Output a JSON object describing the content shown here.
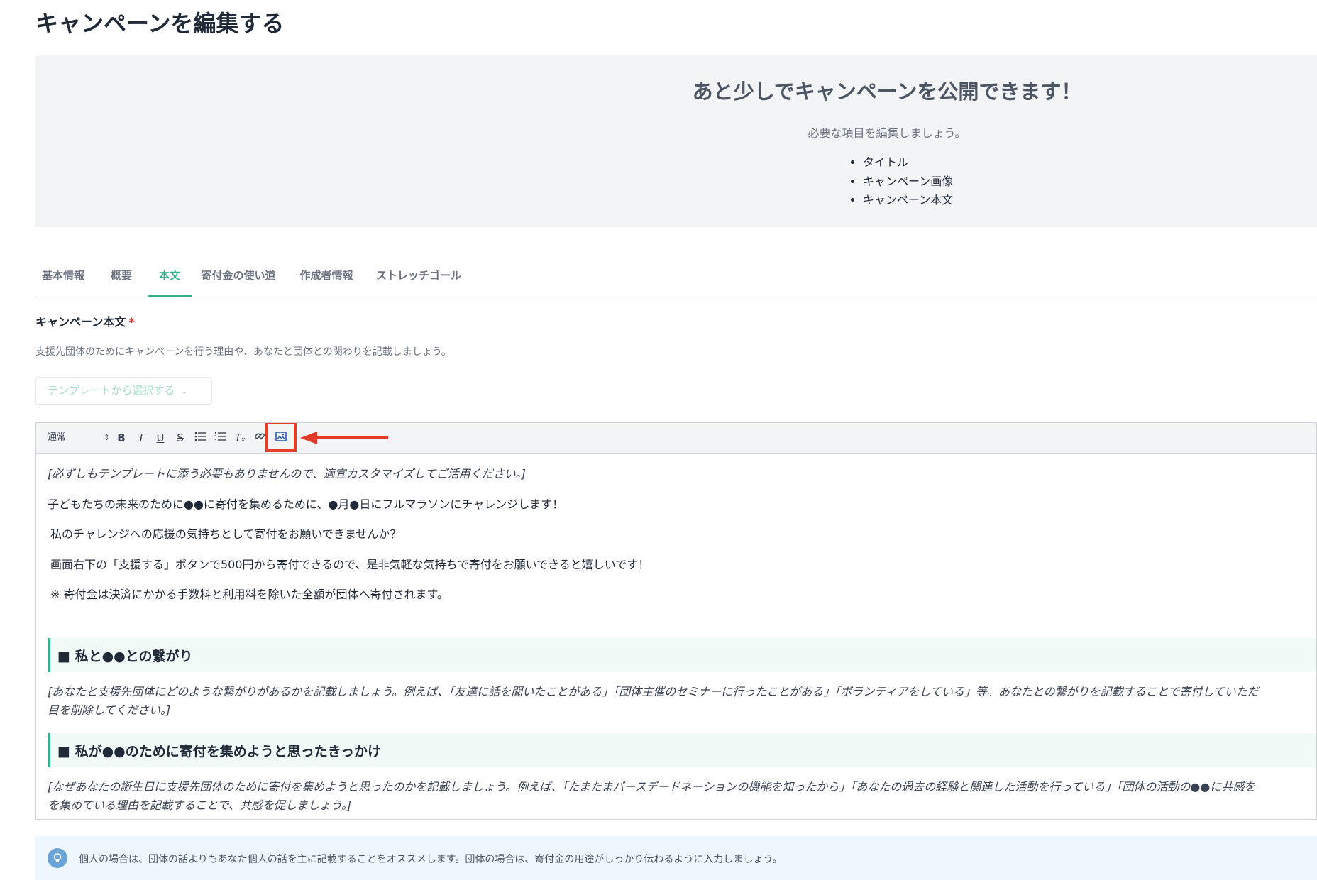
{
  "page": {
    "title": "キャンペーンを編集する"
  },
  "notice": {
    "heading": "あと少しでキャンペーンを公開できます！",
    "subheading": "必要な項目を編集しましょう。",
    "items": [
      "タイトル",
      "キャンペーン画像",
      "キャンペーン本文"
    ]
  },
  "tabs": [
    {
      "label": "基本情報",
      "active": false
    },
    {
      "label": "概要",
      "active": false
    },
    {
      "label": "本文",
      "active": true
    },
    {
      "label": "寄付金の使い道",
      "active": false
    },
    {
      "label": "作成者情報",
      "active": false
    },
    {
      "label": "ストレッチゴール",
      "active": false
    }
  ],
  "field": {
    "label": "キャンペーン本文",
    "required_mark": "*",
    "description": "支援先団体のためにキャンペーンを行う理由や、あなたと団体との関わりを記載しましょう。"
  },
  "template_button": {
    "label": "テンプレートから選択する"
  },
  "toolbar": {
    "format_select": "通常",
    "buttons": [
      "bold",
      "italic",
      "underline",
      "strike",
      "bullet-list",
      "ordered-list",
      "clear-format",
      "link",
      "image"
    ]
  },
  "content": {
    "intro_note": "[必ずしもテンプレートに添う必要もありませんので、適宜カスタマイズしてご活用ください。]",
    "p1": "子どもたちの未来のために●●に寄付を集めるために、●月●日にフルマラソンにチャレンジします！",
    "p2": "私のチャレンジへの応援の気持ちとして寄付をお願いできませんか？",
    "p3": "画面右下の「支援する」ボタンで500円から寄付できるので、是非気軽な気持ちで寄付をお願いできると嬉しいです！",
    "p4": "※ 寄付金は決済にかかる手数料と利用料を除いた全額が団体へ寄付されます。",
    "section1_heading": "■ 私と●●との繋がり",
    "section1_body_line1": "[あなたと支援先団体にどのような繋がりがあるかを記載しましょう。例えば、「友達に話を聞いたことがある」「団体主催のセミナーに行ったことがある」「ボランティアをしている」等。あなたとの繋がりを記載することで寄付していただ",
    "section1_body_line2": "目を削除してください。]",
    "section2_heading": "■ 私が●●のために寄付を集めようと思ったきっかけ",
    "section2_body_line1": "[なぜあなたの誕生日に支援先団体のために寄付を集めようと思ったのかを記載しましょう。例えば、「たまたまバースデードネーションの機能を知ったから」「あなたの過去の経験と関連した活動を行っている」「団体の活動の●●に共感を",
    "section2_body_line2": "を集めている理由を記載することで、共感を促しましょう。]"
  },
  "tip": {
    "text": "個人の場合は、団体の話よりもあなた個人の話を主に記載することをオススメします。団体の場合は、寄付金の用途がしっかり伝わるように入力しましょう。"
  },
  "colors": {
    "accent": "#34b38a",
    "highlight": "#e23d28",
    "tip_bg": "#eef7fd"
  }
}
